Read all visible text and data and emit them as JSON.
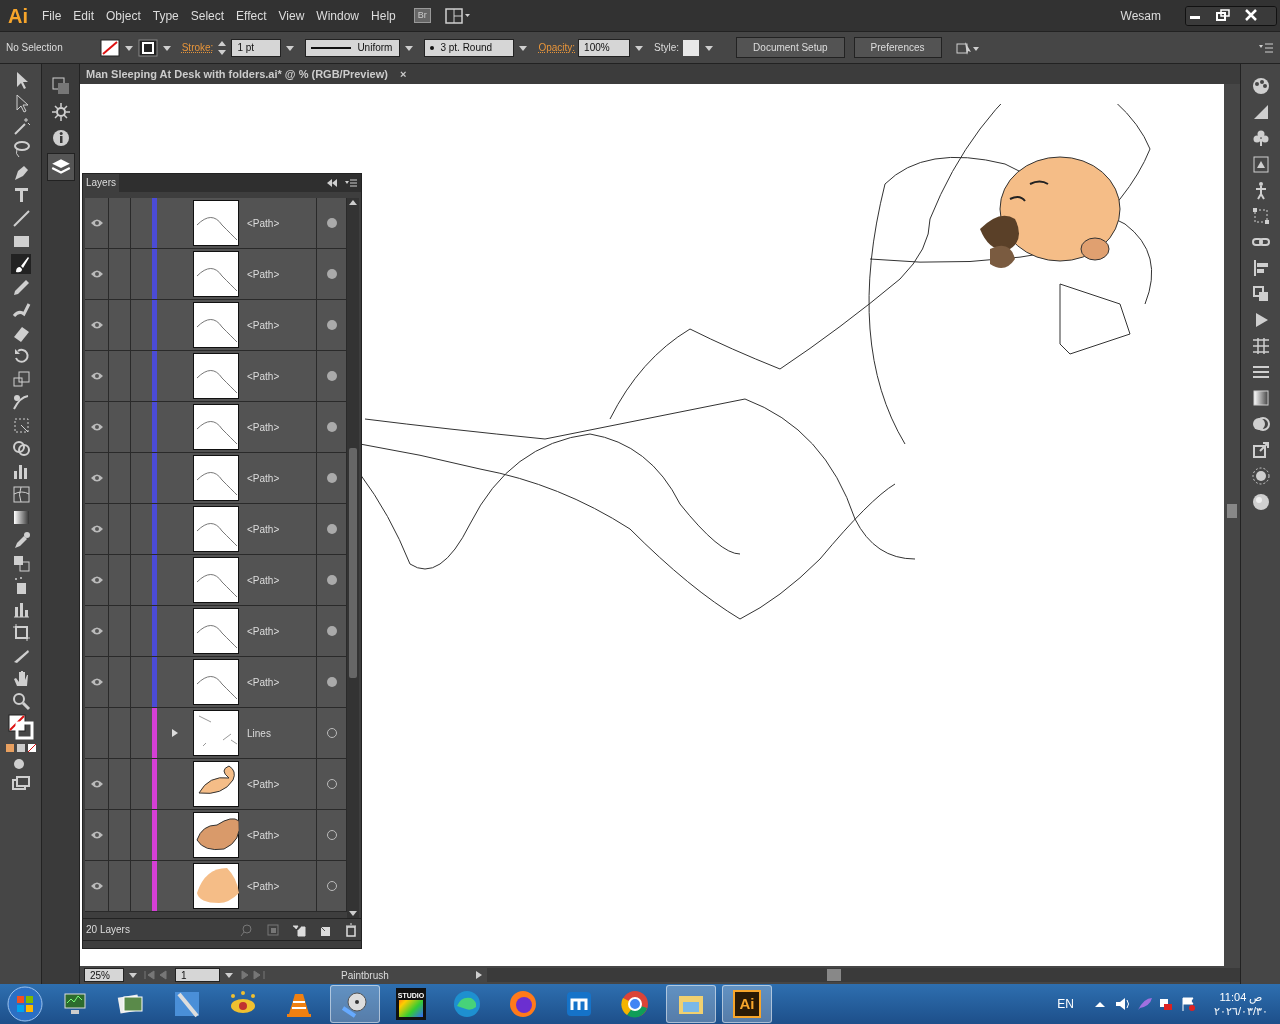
{
  "app": {
    "logo": "Ai",
    "menus": [
      "File",
      "Edit",
      "Object",
      "Type",
      "Select",
      "Effect",
      "View",
      "Window",
      "Help"
    ],
    "bridge": "Br",
    "workspace": "Wesam"
  },
  "control_bar": {
    "selection": "No Selection",
    "stroke_label": "Stroke:",
    "stroke_weight": "1 pt",
    "profile": "Uniform",
    "brush": "3 pt. Round",
    "opacity_label": "Opacity:",
    "opacity": "100%",
    "style_label": "Style:",
    "buttons": [
      "Document Setup",
      "Preferences"
    ]
  },
  "document_tab": {
    "title": "Man Sleeping At Desk with folders.ai* @ % (RGB/Preview)",
    "close": "×"
  },
  "layers_panel": {
    "title": "Layers",
    "footer": "20 Layers",
    "rows": [
      {
        "label": "<Path>",
        "visible": true,
        "expandable": false,
        "filled_target": true,
        "color": "#4b4bd6",
        "kind": "curve"
      },
      {
        "label": "<Path>",
        "visible": true,
        "expandable": false,
        "filled_target": true,
        "color": "#4b4bd6",
        "kind": "curve"
      },
      {
        "label": "<Path>",
        "visible": true,
        "expandable": false,
        "filled_target": true,
        "color": "#4b4bd6",
        "kind": "curve"
      },
      {
        "label": "<Path>",
        "visible": true,
        "expandable": false,
        "filled_target": true,
        "color": "#4b4bd6",
        "kind": "curve"
      },
      {
        "label": "<Path>",
        "visible": true,
        "expandable": false,
        "filled_target": true,
        "color": "#4b4bd6",
        "kind": "curve"
      },
      {
        "label": "<Path>",
        "visible": true,
        "expandable": false,
        "filled_target": true,
        "color": "#4b4bd6",
        "kind": "curve"
      },
      {
        "label": "<Path>",
        "visible": true,
        "expandable": false,
        "filled_target": true,
        "color": "#4b4bd6",
        "kind": "curve"
      },
      {
        "label": "<Path>",
        "visible": true,
        "expandable": false,
        "filled_target": true,
        "color": "#4b4bd6",
        "kind": "curve"
      },
      {
        "label": "<Path>",
        "visible": true,
        "expandable": false,
        "filled_target": true,
        "color": "#4b4bd6",
        "kind": "curve"
      },
      {
        "label": "<Path>",
        "visible": true,
        "expandable": false,
        "filled_target": true,
        "color": "#4b4bd6",
        "kind": "curve"
      },
      {
        "label": "Lines",
        "visible": false,
        "expandable": true,
        "filled_target": false,
        "color": "#d63fd6",
        "kind": "lines"
      },
      {
        "label": "<Path>",
        "visible": true,
        "expandable": false,
        "filled_target": false,
        "color": "#d63fd6",
        "kind": "ear"
      },
      {
        "label": "<Path>",
        "visible": true,
        "expandable": false,
        "filled_target": false,
        "color": "#d63fd6",
        "kind": "mustache"
      },
      {
        "label": "<Path>",
        "visible": true,
        "expandable": false,
        "filled_target": false,
        "color": "#d63fd6",
        "kind": "face"
      }
    ]
  },
  "status_bar": {
    "zoom": "25%",
    "artboard": "1",
    "tool": "Paintbrush"
  },
  "taskbar": {
    "studio_label": "STUDIO",
    "ai_label": "Ai",
    "language": "EN",
    "time": "11:04 ص",
    "date": "٢٠٢٦/٠٣/٣٠"
  }
}
